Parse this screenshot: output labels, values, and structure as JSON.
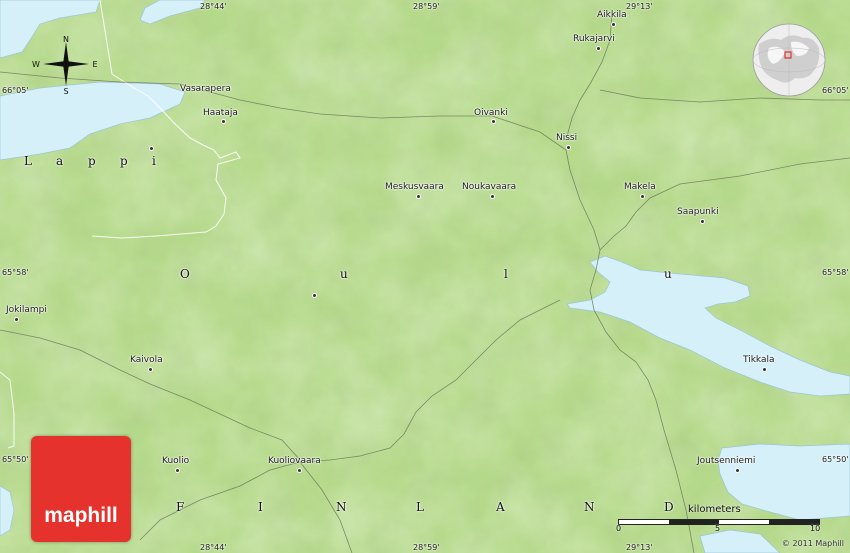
{
  "map": {
    "colors": {
      "land": "#b5d98a",
      "water": "#d6f0fa",
      "border": "#ffffff",
      "road": "#6b7a5a",
      "brand": "#e5322d"
    },
    "compass": {
      "n": "N",
      "s": "S",
      "e": "E",
      "w": "W"
    },
    "coords": {
      "top_284": "28°44'",
      "top_2859": "28°59'",
      "top_2913": "29°13'",
      "bottom_284": "28°44'",
      "bottom_2859": "28°59'",
      "bottom_2913": "29°13'",
      "left_6605": "66°05'",
      "left_6558": "65°58'",
      "left_6550": "65°50'",
      "right_6605": "66°05'",
      "right_6558": "65°58'",
      "right_6550": "65°50'"
    },
    "places": [
      {
        "name": "Aikkila"
      },
      {
        "name": "Rukajarvi"
      },
      {
        "name": "Vasarapera"
      },
      {
        "name": "Haataja"
      },
      {
        "name": "Oivanki"
      },
      {
        "name": "Nissi"
      },
      {
        "name": "Meskusvaara"
      },
      {
        "name": "Noukavaara"
      },
      {
        "name": "Makela"
      },
      {
        "name": "Saapunki"
      },
      {
        "name": "Jokilampi"
      },
      {
        "name": "Kaivola"
      },
      {
        "name": "Tikkala"
      },
      {
        "name": "Kuolio"
      },
      {
        "name": "Kuoliovaara"
      },
      {
        "name": "Joutsenniemi"
      }
    ],
    "regions": {
      "lappi": [
        "L",
        "a",
        "p",
        "p",
        "i"
      ],
      "oulu": [
        "O",
        "u",
        "l",
        "u"
      ],
      "finland": [
        "F",
        "I",
        "N",
        "L",
        "A",
        "N",
        "D"
      ]
    },
    "logo": "maphill",
    "scale": {
      "title": "kilometers",
      "ticks": [
        "0",
        "5",
        "10"
      ]
    },
    "copyright": "© 2011 Maphill"
  }
}
